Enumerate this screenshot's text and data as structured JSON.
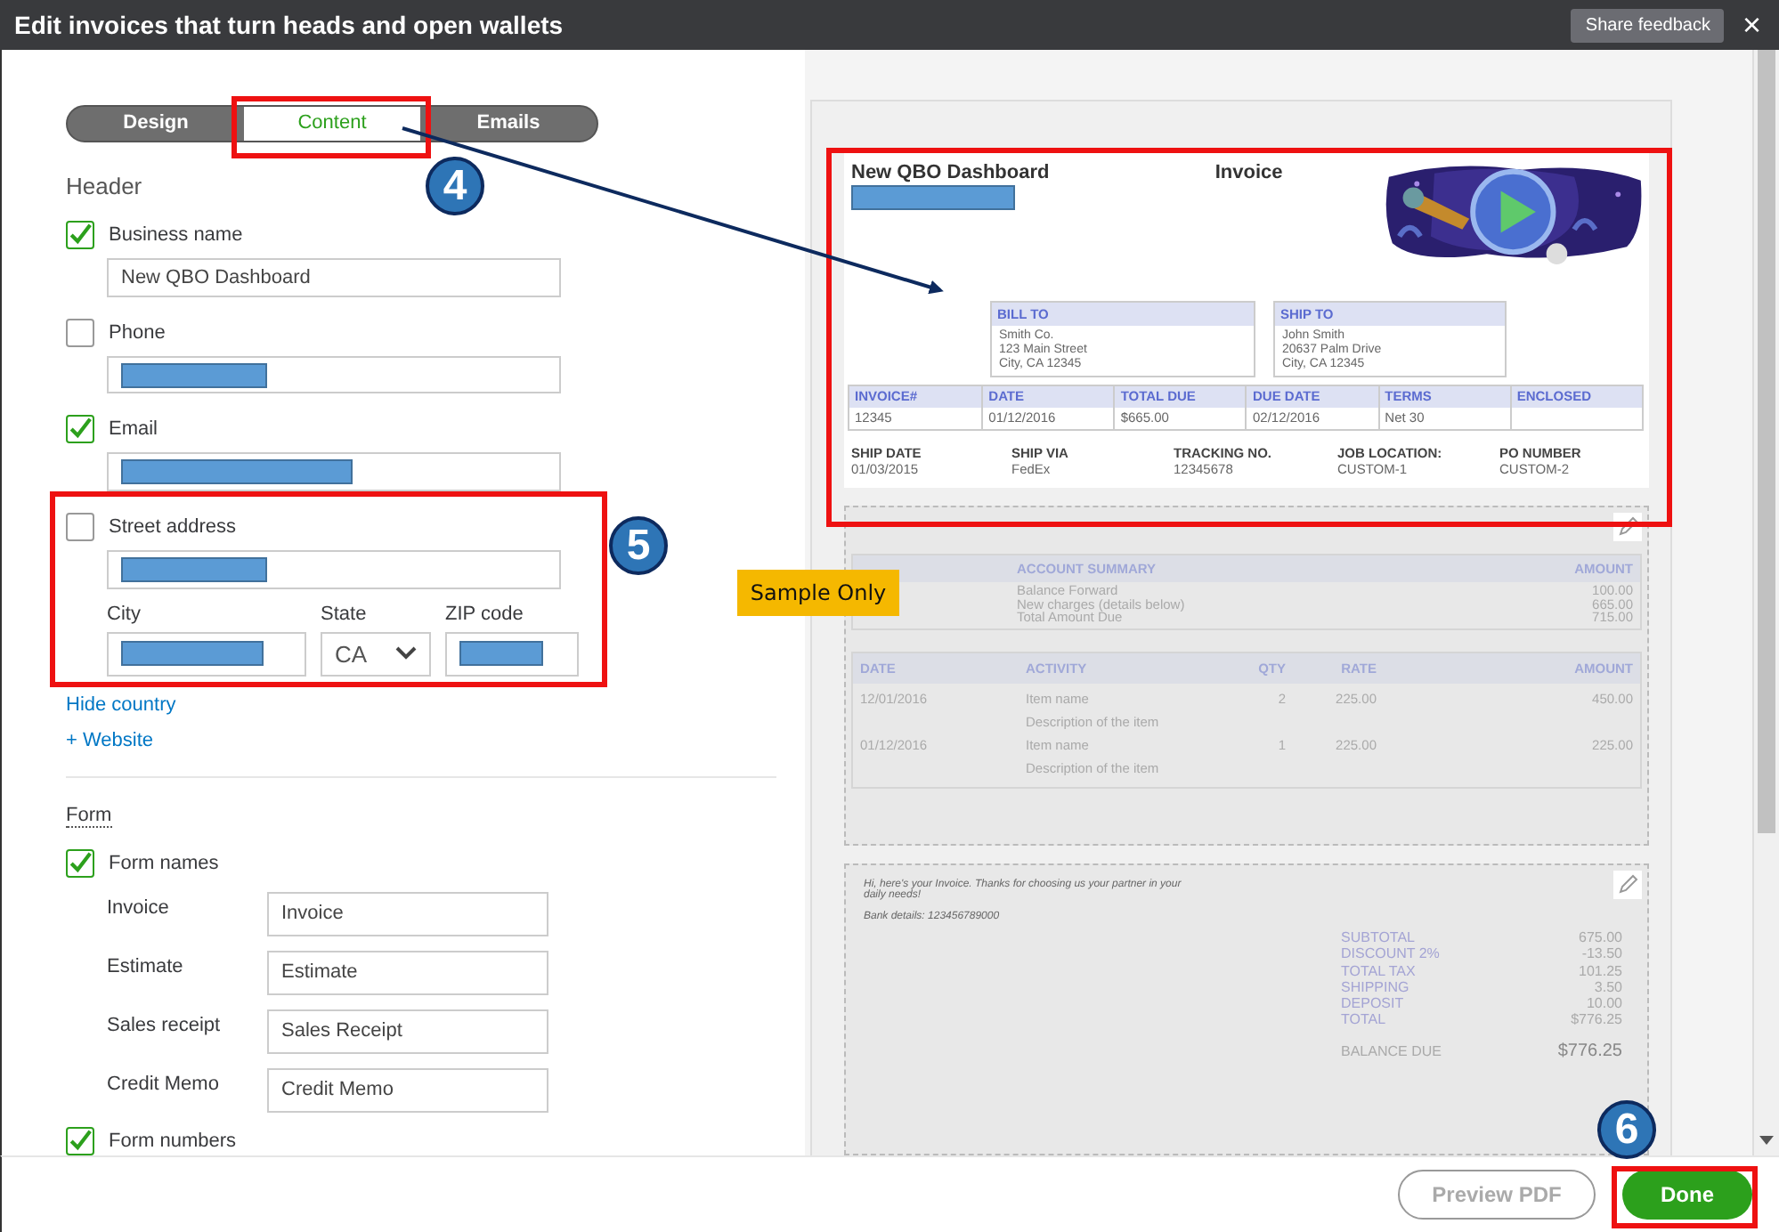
{
  "window": {
    "title": "Edit invoices that turn heads and open wallets",
    "share_feedback": "Share feedback",
    "close": "×"
  },
  "tabs": [
    {
      "label": "Design",
      "selected": false
    },
    {
      "label": "Content",
      "selected": true
    },
    {
      "label": "Emails",
      "selected": false
    }
  ],
  "header_section": {
    "title": "Header",
    "items": [
      {
        "kind": "text",
        "label": "Business name",
        "checked": true,
        "value": "New QBO Dashboard"
      },
      {
        "kind": "redacted",
        "label": "Phone",
        "checked": false
      },
      {
        "kind": "redacted",
        "label": "Email",
        "checked": true
      },
      {
        "kind": "address",
        "label": "Street address",
        "checked": false,
        "city_label": "City",
        "state_label": "State",
        "state_value": "CA",
        "zip_label": "ZIP code"
      }
    ],
    "links": [
      "Hide country",
      "+ Website"
    ]
  },
  "form_section": {
    "title": "Form",
    "form_names": {
      "label": "Form names",
      "checked": true,
      "rows": [
        {
          "label": "Invoice",
          "value": "Invoice"
        },
        {
          "label": "Estimate",
          "value": "Estimate"
        },
        {
          "label": "Sales receipt",
          "value": "Sales Receipt"
        },
        {
          "label": "Credit Memo",
          "value": "Credit Memo"
        }
      ]
    },
    "form_numbers": {
      "label": "Form numbers",
      "checked": true
    }
  },
  "sample_label": "Sample Only",
  "preview": {
    "business": "New QBO Dashboard",
    "doc_title": "Invoice",
    "addresses": [
      {
        "title": "BILL TO",
        "lines": [
          "Smith Co.",
          "123 Main Street",
          "City, CA 12345"
        ]
      },
      {
        "title": "SHIP TO",
        "lines": [
          "John Smith",
          "20637 Palm Drive",
          "City, CA 12345"
        ]
      }
    ],
    "meta": [
      {
        "label": "INVOICE#",
        "value": "12345"
      },
      {
        "label": "DATE",
        "value": "01/12/2016"
      },
      {
        "label": "TOTAL DUE",
        "value": "$665.00"
      },
      {
        "label": "DUE DATE",
        "value": "02/12/2016"
      },
      {
        "label": "TERMS",
        "value": "Net 30"
      },
      {
        "label": "ENCLOSED"
      }
    ],
    "shipping": [
      {
        "label": "SHIP DATE",
        "value": "01/03/2015"
      },
      {
        "label": "SHIP VIA",
        "value": "FedEx"
      },
      {
        "label": "TRACKING NO.",
        "value": "12345678"
      },
      {
        "label": "JOB LOCATION:",
        "value": "CUSTOM-1"
      },
      {
        "label": "PO NUMBER",
        "value": "CUSTOM-2"
      }
    ],
    "summary": {
      "title": "ACCOUNT SUMMARY",
      "amount_label": "AMOUNT",
      "lines": [
        "Balance Forward",
        "New charges (details below)",
        "Total Amount Due"
      ],
      "amounts": [
        "100.00",
        "665.00",
        "715.00"
      ]
    },
    "activity": {
      "columns": [
        "DATE",
        "ACTIVITY",
        "QTY",
        "RATE",
        "AMOUNT"
      ],
      "rows": [
        {
          "date": "12/01/2016",
          "name": "Item name",
          "description": "Description of the item",
          "qty": "2",
          "rate": "225.00",
          "amount": "450.00"
        },
        {
          "date": "01/12/2016",
          "name": "Item name",
          "description": "Description of the item",
          "qty": "1",
          "rate": "225.00",
          "amount": "225.00"
        }
      ]
    },
    "message": "Hi, here's your Invoice. Thanks for choosing us your partner in your daily needs!",
    "bank": "Bank details: 123456789000",
    "totals": [
      {
        "label": "SUBTOTAL",
        "value": "675.00"
      },
      {
        "label": "DISCOUNT 2%",
        "value": "-13.50"
      },
      {
        "label": "TOTAL TAX",
        "value": "101.25"
      },
      {
        "label": "SHIPPING",
        "value": "3.50"
      },
      {
        "label": "DEPOSIT",
        "value": "10.00"
      },
      {
        "label": "TOTAL",
        "value": "$776.25"
      }
    ],
    "balance": {
      "label": "BALANCE DUE",
      "value": "$776.25"
    }
  },
  "buttons": {
    "preview": "Preview PDF",
    "done": "Done"
  },
  "callouts": [
    "4",
    "5",
    "6"
  ]
}
